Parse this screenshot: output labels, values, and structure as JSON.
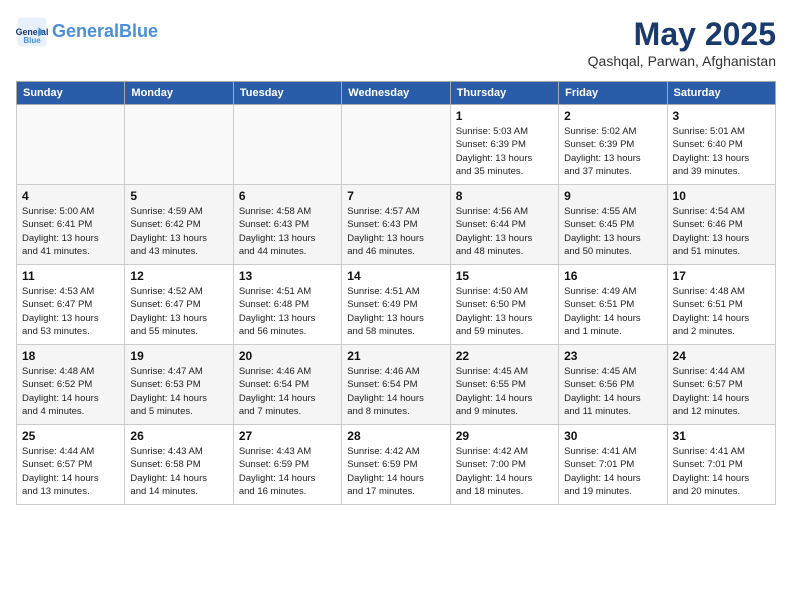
{
  "logo": {
    "line1": "General",
    "line2": "Blue"
  },
  "title": "May 2025",
  "location": "Qashqal, Parwan, Afghanistan",
  "weekdays": [
    "Sunday",
    "Monday",
    "Tuesday",
    "Wednesday",
    "Thursday",
    "Friday",
    "Saturday"
  ],
  "weeks": [
    [
      {
        "day": "",
        "info": ""
      },
      {
        "day": "",
        "info": ""
      },
      {
        "day": "",
        "info": ""
      },
      {
        "day": "",
        "info": ""
      },
      {
        "day": "1",
        "info": "Sunrise: 5:03 AM\nSunset: 6:39 PM\nDaylight: 13 hours\nand 35 minutes."
      },
      {
        "day": "2",
        "info": "Sunrise: 5:02 AM\nSunset: 6:39 PM\nDaylight: 13 hours\nand 37 minutes."
      },
      {
        "day": "3",
        "info": "Sunrise: 5:01 AM\nSunset: 6:40 PM\nDaylight: 13 hours\nand 39 minutes."
      }
    ],
    [
      {
        "day": "4",
        "info": "Sunrise: 5:00 AM\nSunset: 6:41 PM\nDaylight: 13 hours\nand 41 minutes."
      },
      {
        "day": "5",
        "info": "Sunrise: 4:59 AM\nSunset: 6:42 PM\nDaylight: 13 hours\nand 43 minutes."
      },
      {
        "day": "6",
        "info": "Sunrise: 4:58 AM\nSunset: 6:43 PM\nDaylight: 13 hours\nand 44 minutes."
      },
      {
        "day": "7",
        "info": "Sunrise: 4:57 AM\nSunset: 6:43 PM\nDaylight: 13 hours\nand 46 minutes."
      },
      {
        "day": "8",
        "info": "Sunrise: 4:56 AM\nSunset: 6:44 PM\nDaylight: 13 hours\nand 48 minutes."
      },
      {
        "day": "9",
        "info": "Sunrise: 4:55 AM\nSunset: 6:45 PM\nDaylight: 13 hours\nand 50 minutes."
      },
      {
        "day": "10",
        "info": "Sunrise: 4:54 AM\nSunset: 6:46 PM\nDaylight: 13 hours\nand 51 minutes."
      }
    ],
    [
      {
        "day": "11",
        "info": "Sunrise: 4:53 AM\nSunset: 6:47 PM\nDaylight: 13 hours\nand 53 minutes."
      },
      {
        "day": "12",
        "info": "Sunrise: 4:52 AM\nSunset: 6:47 PM\nDaylight: 13 hours\nand 55 minutes."
      },
      {
        "day": "13",
        "info": "Sunrise: 4:51 AM\nSunset: 6:48 PM\nDaylight: 13 hours\nand 56 minutes."
      },
      {
        "day": "14",
        "info": "Sunrise: 4:51 AM\nSunset: 6:49 PM\nDaylight: 13 hours\nand 58 minutes."
      },
      {
        "day": "15",
        "info": "Sunrise: 4:50 AM\nSunset: 6:50 PM\nDaylight: 13 hours\nand 59 minutes."
      },
      {
        "day": "16",
        "info": "Sunrise: 4:49 AM\nSunset: 6:51 PM\nDaylight: 14 hours\nand 1 minute."
      },
      {
        "day": "17",
        "info": "Sunrise: 4:48 AM\nSunset: 6:51 PM\nDaylight: 14 hours\nand 2 minutes."
      }
    ],
    [
      {
        "day": "18",
        "info": "Sunrise: 4:48 AM\nSunset: 6:52 PM\nDaylight: 14 hours\nand 4 minutes."
      },
      {
        "day": "19",
        "info": "Sunrise: 4:47 AM\nSunset: 6:53 PM\nDaylight: 14 hours\nand 5 minutes."
      },
      {
        "day": "20",
        "info": "Sunrise: 4:46 AM\nSunset: 6:54 PM\nDaylight: 14 hours\nand 7 minutes."
      },
      {
        "day": "21",
        "info": "Sunrise: 4:46 AM\nSunset: 6:54 PM\nDaylight: 14 hours\nand 8 minutes."
      },
      {
        "day": "22",
        "info": "Sunrise: 4:45 AM\nSunset: 6:55 PM\nDaylight: 14 hours\nand 9 minutes."
      },
      {
        "day": "23",
        "info": "Sunrise: 4:45 AM\nSunset: 6:56 PM\nDaylight: 14 hours\nand 11 minutes."
      },
      {
        "day": "24",
        "info": "Sunrise: 4:44 AM\nSunset: 6:57 PM\nDaylight: 14 hours\nand 12 minutes."
      }
    ],
    [
      {
        "day": "25",
        "info": "Sunrise: 4:44 AM\nSunset: 6:57 PM\nDaylight: 14 hours\nand 13 minutes."
      },
      {
        "day": "26",
        "info": "Sunrise: 4:43 AM\nSunset: 6:58 PM\nDaylight: 14 hours\nand 14 minutes."
      },
      {
        "day": "27",
        "info": "Sunrise: 4:43 AM\nSunset: 6:59 PM\nDaylight: 14 hours\nand 16 minutes."
      },
      {
        "day": "28",
        "info": "Sunrise: 4:42 AM\nSunset: 6:59 PM\nDaylight: 14 hours\nand 17 minutes."
      },
      {
        "day": "29",
        "info": "Sunrise: 4:42 AM\nSunset: 7:00 PM\nDaylight: 14 hours\nand 18 minutes."
      },
      {
        "day": "30",
        "info": "Sunrise: 4:41 AM\nSunset: 7:01 PM\nDaylight: 14 hours\nand 19 minutes."
      },
      {
        "day": "31",
        "info": "Sunrise: 4:41 AM\nSunset: 7:01 PM\nDaylight: 14 hours\nand 20 minutes."
      }
    ]
  ]
}
